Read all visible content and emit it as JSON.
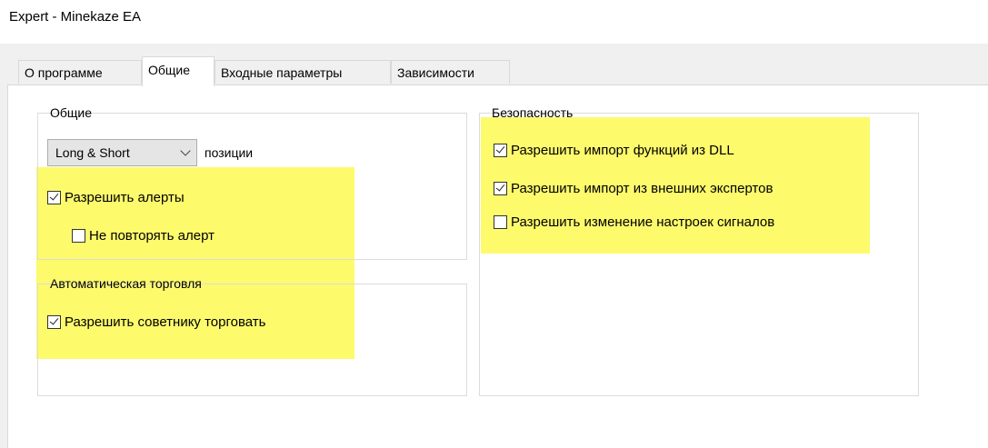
{
  "window": {
    "title": "Expert - Minekaze EA"
  },
  "tabs": [
    {
      "label": "О программе",
      "active": false
    },
    {
      "label": "Общие",
      "active": true
    },
    {
      "label": "Входные параметры",
      "active": false
    },
    {
      "label": "Зависимости",
      "active": false
    }
  ],
  "general_group": {
    "legend": "Общие",
    "position_select": {
      "value": "Long & Short",
      "suffix": "позиции"
    },
    "allow_alerts": {
      "label": "Разрешить алерты",
      "checked": true
    },
    "no_repeat_alert": {
      "label": "Не повторять алерт",
      "checked": false
    }
  },
  "auto_trading_group": {
    "legend": "Автоматическая торговля",
    "allow_ea_trading": {
      "label": "Разрешить советнику торговать",
      "checked": true
    }
  },
  "security_group": {
    "legend": "Безопасность",
    "allow_dll_import": {
      "label": "Разрешить импорт функций из DLL",
      "checked": true
    },
    "allow_external_experts": {
      "label": "Разрешить импорт из внешних экспертов",
      "checked": true
    },
    "allow_signal_settings": {
      "label": "Разрешить изменение настроек сигналов",
      "checked": false
    }
  },
  "colors": {
    "highlight": "#fdfa6c",
    "dialog_background": "#f0f0f0",
    "panel_background": "#ffffff"
  }
}
